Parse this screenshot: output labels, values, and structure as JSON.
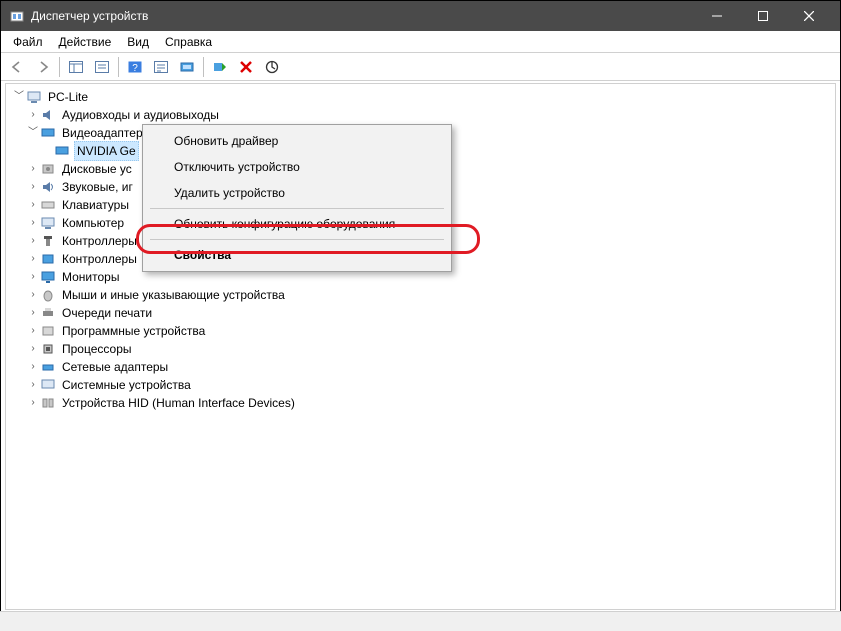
{
  "window": {
    "title": "Диспетчер устройств"
  },
  "menu": {
    "file": "Файл",
    "action": "Действие",
    "view": "Вид",
    "help": "Справка"
  },
  "tree": {
    "root": "PC-Lite",
    "audio": "Аудиовходы и аудиовыходы",
    "video_adapters": "Видеоадаптеры",
    "nvidia": "NVIDIA Ge",
    "disk": "Дисковые ус",
    "sound": "Звуковые, иг",
    "keyboard": "Клавиатуры",
    "computer": "Компьютер",
    "controllers1": "Контроллеры",
    "controllers2": "Контроллеры",
    "monitors": "Мониторы",
    "mice": "Мыши и иные указывающие устройства",
    "print_queue": "Очереди печати",
    "software_devices": "Программные устройства",
    "processors": "Процессоры",
    "network": "Сетевые адаптеры",
    "system": "Системные устройства",
    "hid": "Устройства HID (Human Interface Devices)"
  },
  "context_menu": {
    "update_driver": "Обновить драйвер",
    "disable_device": "Отключить устройство",
    "remove_device": "Удалить устройство",
    "refresh_hw": "Обновить конфигурацию оборудования",
    "properties": "Свойства"
  }
}
